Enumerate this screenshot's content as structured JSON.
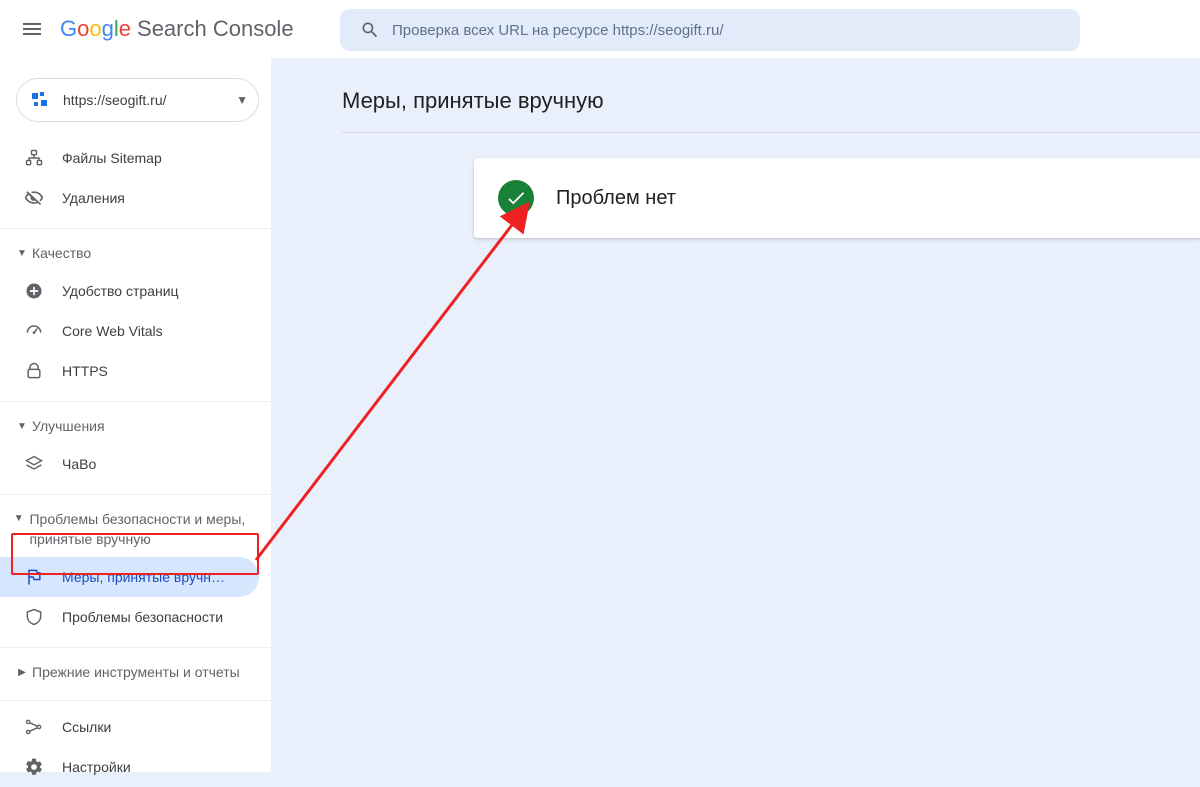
{
  "header": {
    "logo_chars": [
      "G",
      "o",
      "o",
      "g",
      "l",
      "e"
    ],
    "logo_rest": "Search Console",
    "search_placeholder": "Проверка всех URL на ресурсе https://seogift.ru/"
  },
  "sidebar": {
    "property": "https://seogift.ru/",
    "items_top": [
      {
        "icon": "sitemap",
        "label": "Файлы Sitemap"
      },
      {
        "icon": "removals",
        "label": "Удаления"
      }
    ],
    "section_quality": {
      "title": "Качество",
      "items": [
        {
          "icon": "page-experience",
          "label": "Удобство страниц"
        },
        {
          "icon": "vitals",
          "label": "Core Web Vitals"
        },
        {
          "icon": "https",
          "label": "HTTPS"
        }
      ]
    },
    "section_enhancements": {
      "title": "Улучшения",
      "items": [
        {
          "icon": "faq",
          "label": "ЧаВо"
        }
      ]
    },
    "section_security": {
      "title": "Проблемы безопасности и меры, принятые вручную",
      "items": [
        {
          "icon": "flag",
          "label": "Меры, принятые вручн…"
        },
        {
          "icon": "shield",
          "label": "Проблемы безопасности"
        }
      ]
    },
    "section_legacy": {
      "title": "Прежние инструменты и отчеты"
    },
    "items_bottom": [
      {
        "icon": "links",
        "label": "Ссылки"
      },
      {
        "icon": "settings",
        "label": "Настройки"
      }
    ]
  },
  "main": {
    "page_title": "Меры, принятые вручную",
    "status_text": "Проблем нет"
  }
}
